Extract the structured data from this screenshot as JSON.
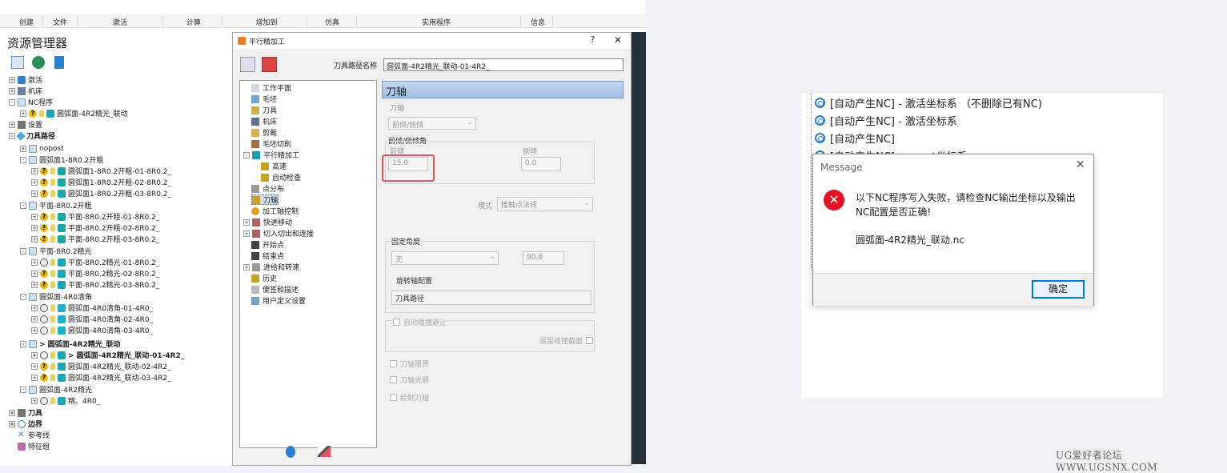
{
  "ribbon": {
    "tabs": [
      "创建",
      "文件",
      "激活",
      "计算",
      "增加到",
      "仿真",
      "实用程序",
      "信息"
    ]
  },
  "resource": {
    "title": "资源管理器"
  },
  "tree": {
    "items": [
      {
        "label": "激活"
      },
      {
        "label": "机床"
      },
      {
        "label": "NC程序"
      },
      {
        "label": "圆弧面-4R2精光_联动"
      },
      {
        "label": "设置"
      },
      {
        "label": "刀具路径"
      },
      {
        "label": "nopost"
      },
      {
        "label": "圆弧面1-8R0.2开粗"
      },
      {
        "label": "圆弧面1-8R0.2开粗-01-8R0.2_"
      },
      {
        "label": "圆弧面1-8R0.2开粗-02-8R0.2_"
      },
      {
        "label": "圆弧面1-8R0.2开粗-03-8R0.2_"
      },
      {
        "label": "平面-8R0.2开粗"
      },
      {
        "label": "平面-8R0.2开粗-01-8R0.2_"
      },
      {
        "label": "平面-8R0.2开粗-02-8R0.2_"
      },
      {
        "label": "平面-8R0.2开粗-03-8R0.2_"
      },
      {
        "label": "平面-8R0.2精光"
      },
      {
        "label": "平面-8R0.2精光-01-8R0.2_"
      },
      {
        "label": "平面-8R0.2精光-02-8R0.2_"
      },
      {
        "label": "平面-8R0.2精光-03-8R0.2_"
      },
      {
        "label": "圆弧面-4R0清角"
      },
      {
        "label": "圆弧面-4R0清角-01-4R0_"
      },
      {
        "label": "圆弧面-4R0清角-02-4R0_"
      },
      {
        "label": "圆弧面-4R0清角-03-4R0_"
      },
      {
        "label": "> 圆弧面-4R2精光_联动"
      },
      {
        "label": "> 圆弧面-4R2精光_联动-01-4R2_"
      },
      {
        "label": "圆弧面-4R2精光_联动-02-4R2_"
      },
      {
        "label": "圆弧面-4R2精光_联动-03-4R2_"
      },
      {
        "label": "圆弧面-4R2精光"
      },
      {
        "label": "精。4R0_"
      },
      {
        "label": "刀具"
      },
      {
        "label": "边界"
      },
      {
        "label": "参考线"
      },
      {
        "label": "特征组"
      }
    ]
  },
  "dialog": {
    "title": "平行精加工",
    "help": "?",
    "close": "✕",
    "toolpath_name_label": "刀具路径名称",
    "toolpath_name_value": "圆弧面-4R2精光_联动-01-4R2_",
    "nav": [
      "工作平面",
      "毛坯",
      "刀具",
      "机床",
      "剪裁",
      "毛坯切削",
      "平行精加工",
      "高速",
      "自动检查",
      "点分布",
      "刀轴",
      "加工轴控制",
      "快进移动",
      "切入切出和连接",
      "开始点",
      "结束点",
      "进给和转速",
      "历史",
      "便签和描述",
      "用户定义设置"
    ],
    "panel": {
      "header": "刀轴",
      "axis_label": "刀轴",
      "axis_value": "前倾/侧倾",
      "tilt_group": "前倾/侧倾角",
      "lead_label": "前倾",
      "lead_value": "15.0",
      "lean_label": "侧倾",
      "lean_value": "0.0",
      "mode_label": "模式",
      "mode_value": "接触点法线",
      "fixed_angle_label": "固定角度",
      "fixed_value": "无",
      "fixed_angle_value": "90.0",
      "rotary_label": "旋转轴配置",
      "rotary_value": "刀具路径",
      "auto_avoid": "自动碰撞避让",
      "keep_surface": "保留碰撞截面",
      "axis_limits": "刀轴限界",
      "axis_smooth": "刀轴光顺",
      "draw_axis": "绘制刀轴"
    }
  },
  "nc_list": {
    "items": [
      "[自动产生NC] - 激活坐标系 （不删除已有NC)",
      "[自动产生NC] - 激活坐标系",
      "[自动产生NC]",
      "[自动产生NC]-----post坐标系"
    ]
  },
  "message": {
    "title": "Message",
    "close": "✕",
    "icon": "✕",
    "text": "以下NC程序写入失败，请检查NC输出坐标以及输出NC配置是否正确!",
    "file": "圆弧面-4R2精光_联动.nc",
    "ok": "确定"
  },
  "watermark": "UG爱好者论坛 WWW.UGSNX.COM"
}
